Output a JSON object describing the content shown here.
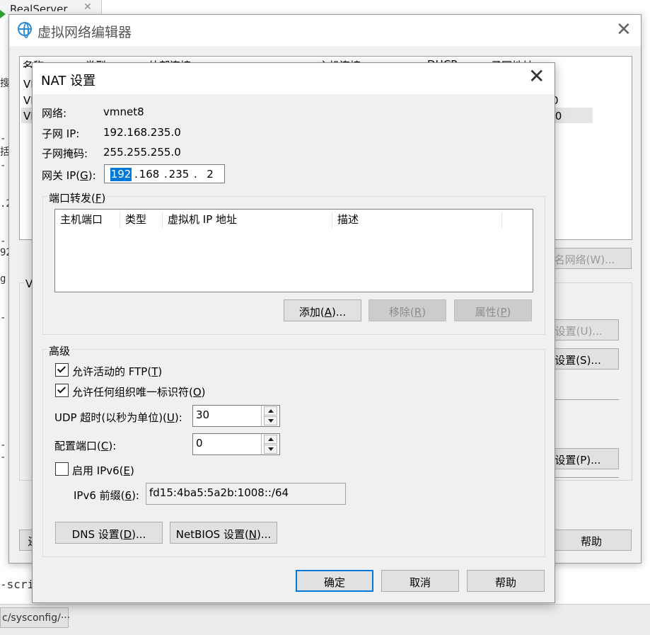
{
  "background": {
    "tab_title": "RealServer",
    "terminal_fragments": [
      "搜",
      "VI",
      "VI",
      "VI",
      "-",
      "括",
      "-",
      ".2",
      "-",
      "92",
      "g",
      "-",
      "-",
      "-"
    ],
    "bottom_text": "-scri",
    "bottom_tab": "c/sysconfig/···"
  },
  "vne": {
    "title": "虚拟网络编辑器",
    "columns": [
      "名称",
      "类型",
      "外部连接",
      "主机连接",
      "DHCP",
      "子网地址"
    ],
    "row_fragments": [
      "0",
      ".0"
    ],
    "rename_button": "命名网络(W)...",
    "group_label": "V",
    "dhcp_button": "D 设置(U)...",
    "nat_button": "T 设置(S)...",
    "dhcp_p_button": "P 设置(P)...",
    "restore_button": "还",
    "help_button": "帮助"
  },
  "nat": {
    "title": "NAT 设置",
    "network_label": "网络:",
    "network_value": "vmnet8",
    "subnet_ip_label": "子网 IP:",
    "subnet_ip_value": "192.168.235.0",
    "subnet_mask_label": "子网掩码:",
    "subnet_mask_value": "255.255.255.0",
    "gateway_label_pre": "网关 IP(",
    "gateway_label_key": "G",
    "gateway_label_post": "):",
    "gateway_octets": [
      "192",
      "168",
      "235",
      "2"
    ],
    "port_forwarding": {
      "label_pre": "端口转发(",
      "label_key": "F",
      "label_post": ")",
      "columns": [
        "主机端口",
        "类型",
        "虚拟机 IP 地址",
        "描述"
      ],
      "add_pre": "添加(",
      "add_key": "A",
      "add_post": ")...",
      "remove_pre": "移除(",
      "remove_key": "R",
      "remove_post": ")",
      "props_pre": "属性(",
      "props_key": "P",
      "props_post": ")"
    },
    "advanced": {
      "label": "高级",
      "allow_ftp_pre": "允许活动的 FTP(",
      "allow_ftp_key": "T",
      "allow_ftp_post": ")",
      "allow_ftp_checked": true,
      "allow_oui_pre": "允许任何组织唯一标识符(",
      "allow_oui_key": "O",
      "allow_oui_post": ")",
      "allow_oui_checked": true,
      "udp_timeout_pre": "UDP 超时(以秒为单位)(",
      "udp_timeout_key": "U",
      "udp_timeout_post": "):",
      "udp_timeout_value": "30",
      "config_port_pre": "配置端口(",
      "config_port_key": "C",
      "config_port_post": "):",
      "config_port_value": "0",
      "ipv6_pre": "启用 IPv6(",
      "ipv6_key": "E",
      "ipv6_post": ")",
      "ipv6_checked": false,
      "ipv6_prefix_pre": "IPv6 前缀(",
      "ipv6_prefix_key": "6",
      "ipv6_prefix_post": "):",
      "ipv6_prefix_value": "fd15:4ba5:5a2b:1008::/64",
      "dns_pre": "DNS 设置(",
      "dns_key": "D",
      "dns_post": ")...",
      "netbios_pre": "NetBIOS 设置(",
      "netbios_key": "N",
      "netbios_post": ")..."
    },
    "ok": "确定",
    "cancel": "取消",
    "help": "帮助"
  }
}
